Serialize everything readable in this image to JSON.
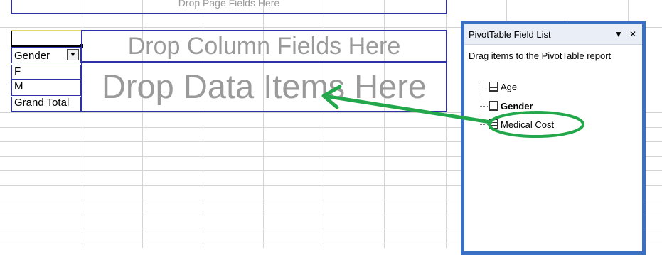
{
  "pivot": {
    "page_fields_drop": "Drop Page Fields Here",
    "column_fields_drop": "Drop Column Fields Here",
    "data_items_drop": "Drop Data Items Here",
    "row_field": "Gender",
    "row_items": [
      "F",
      "M",
      "Grand Total"
    ]
  },
  "field_list": {
    "title": "PivotTable Field List",
    "instruction": "Drag items to the PivotTable report",
    "fields": [
      "Age",
      "Gender",
      "Medical Cost"
    ],
    "dropdown_symbol": "▼",
    "close_symbol": "✕"
  },
  "colors": {
    "pivot_border": "#2f2fa6",
    "annotation_green": "#22a84a",
    "panel_frame": "#3a6fc4"
  },
  "icons": {
    "dropdown": "dropdown-arrow-icon",
    "field": "field-list-icon",
    "annotation": "green-arrow-annotation"
  }
}
